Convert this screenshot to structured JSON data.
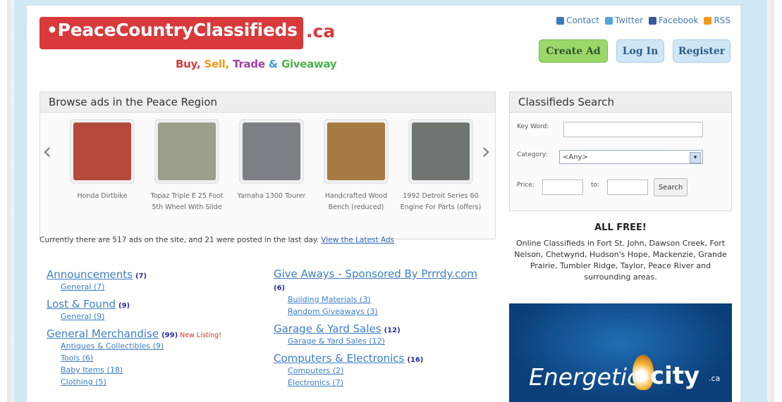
{
  "logo": {
    "main": "•PeaceCountryClassifieds",
    "tld": ".ca"
  },
  "tagline": {
    "buy": "Buy,",
    "sell": "Sell,",
    "trade": "Trade",
    "amp": "&",
    "giveaway": "Giveaway"
  },
  "social": [
    {
      "label": "Contact",
      "icon": "contact-icon",
      "color": "#3c7ab8"
    },
    {
      "label": "Twitter",
      "icon": "twitter-icon",
      "color": "#57a6d9"
    },
    {
      "label": "Facebook",
      "icon": "facebook-icon",
      "color": "#3b5998"
    },
    {
      "label": "RSS",
      "icon": "rss-icon",
      "color": "#f39a1d"
    }
  ],
  "buttons": {
    "create": "Create Ad",
    "login": "Log In",
    "register": "Register"
  },
  "browse": {
    "title": "Browse ads in the Peace Region",
    "prev": "‹",
    "next": "›",
    "items": [
      {
        "caption": "Honda Dirtbike",
        "color": "#b54a3c"
      },
      {
        "caption": "Topaz Triple E 25 Foot 5th Wheel With Slide",
        "color": "#9aa08a"
      },
      {
        "caption": "Yamaha 1300 Tourer",
        "color": "#7b8087"
      },
      {
        "caption": "Handcrafted Wood Bench (reduced)",
        "color": "#a67b43"
      },
      {
        "caption": "1992 Detroit Series 60 Engine For Parts (offers)",
        "color": "#6f7670"
      }
    ]
  },
  "count_line": {
    "text": "Currently there are 517 ads on the site, and 21 were posted in the last day.",
    "link": "View the Latest Ads"
  },
  "categories_left": [
    {
      "title": "Announcements",
      "count": "(7)",
      "subs": [
        "General (7)"
      ]
    },
    {
      "title": "Lost & Found",
      "count": "(9)",
      "subs": [
        "General (9)"
      ]
    },
    {
      "title": "General Merchandise",
      "count": "(99)",
      "new": "New Listing!",
      "subs": [
        "Antiques & Collectibles (9)",
        "Tools (6)",
        "Baby Items (18)",
        "Clothing (5)"
      ]
    }
  ],
  "categories_right": [
    {
      "title": "Give Aways - Sponsored By Prrrdy.com",
      "count": "(6)",
      "subs": [
        "Building Materials (3)",
        "Random Giveaways (3)"
      ]
    },
    {
      "title": "Garage & Yard Sales",
      "count": "(12)",
      "subs": [
        "Garage & Yard Sales (12)"
      ]
    },
    {
      "title": "Computers & Electronics",
      "count": "(16)",
      "subs": [
        "Computers (2)",
        "Electronics (7)"
      ]
    }
  ],
  "search": {
    "title": "Classifieds Search",
    "keyword_label": "Key Word:",
    "category_label": "Category:",
    "category_value": "<Any>",
    "price_label": "Price:",
    "to_label": "to:",
    "button": "Search"
  },
  "free": {
    "title": "ALL FREE!",
    "text": "Online Classifieds in Fort St. John, Dawson Creek, Fort Nelson, Chetwynd, Hudson's Hope, Mackenzie, Grande Prairie, Tumbler Ridge, Taylor, Peace River and surrounding areas."
  },
  "ad": {
    "text": "Energetic",
    "city": "city",
    "tld": ".ca"
  }
}
